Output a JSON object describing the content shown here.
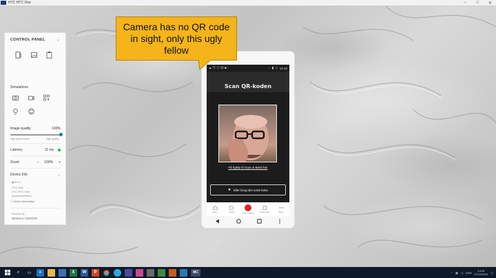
{
  "window": {
    "title": "HTC HTC One",
    "controls": [
      "–",
      "□",
      "✕"
    ]
  },
  "control_panel": {
    "title": "CONTROL PANEL",
    "simulations_label": "Simulations",
    "image_quality": {
      "label": "Image quality",
      "value": "100%",
      "low_label": "High performance",
      "high_label": "High quality",
      "level": 1.0
    },
    "latency": {
      "label": "Latency",
      "value": "11 ms"
    },
    "zoom": {
      "label": "Zoom",
      "minus": "–",
      "value": "100%",
      "plus": "+"
    },
    "device_info": {
      "label": "Device Info",
      "os": "8.0.0",
      "model_line1": "HTC One",
      "model_line2": "HTC HTC One",
      "serial": "(emmc##000xx)",
      "more_info": "More information"
    },
    "powered_by": "Powered by",
    "brand": "MOBILE CENTER"
  },
  "callout": {
    "text": "Camera has no QR code in sight, only this ugly fellow"
  },
  "phone": {
    "status_time": "14:15",
    "screen_title": "Scan QR-koden",
    "help_link": "Få hjælp til Scan & Betal her",
    "alt_button": "Eller brug den sorte boks",
    "nav": [
      {
        "label": "Hjem",
        "icon": "home-icon"
      },
      {
        "label": "Tilbud",
        "icon": "tag-icon"
      },
      {
        "label": "Scan & Betal",
        "icon": "scan-icon"
      },
      {
        "label": "Kvitteringer",
        "icon": "receipt-icon"
      },
      {
        "label": "Mere",
        "icon": "more-icon"
      }
    ]
  },
  "taskbar": {
    "lang": "DAN",
    "time": "14:15",
    "date": "07/11/2019"
  },
  "colors": {
    "callout": "#f4b41a",
    "accent_blue": "#0a7fb8",
    "scan_red": "#d3262b",
    "taskbar": "#0e1a2b"
  }
}
